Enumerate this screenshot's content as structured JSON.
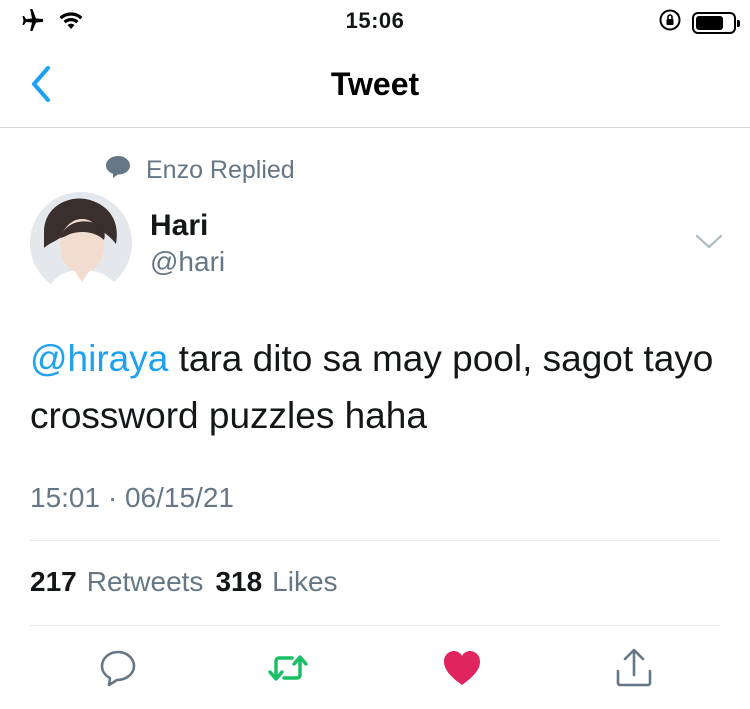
{
  "status_bar": {
    "time": "15:06",
    "left_icons": [
      "airplane-icon",
      "wifi-icon"
    ],
    "right_icons": [
      "orientation-lock-icon",
      "battery-icon"
    ],
    "battery_level": 0.75
  },
  "nav": {
    "title": "Tweet",
    "back_icon": "chevron-left-icon"
  },
  "tweet": {
    "context_icon": "speech-bubble-icon",
    "context_text": "Enzo Replied",
    "author": {
      "name": "Hari",
      "handle": "@hari"
    },
    "text": {
      "mention": "@hiraya",
      "body": " tara dito sa may pool, sagot tayo crossword puzzles haha"
    },
    "time": "15:01",
    "separator": "·",
    "date": "06/15/21",
    "stats": {
      "retweets_count": "217",
      "retweets_label": "Retweets",
      "likes_count": "318",
      "likes_label": "Likes"
    }
  },
  "actions": [
    "reply-icon",
    "retweet-icon",
    "like-icon",
    "share-icon"
  ],
  "colors": {
    "accent": "#1da1f2",
    "secondary_text": "#657786",
    "retweet_active": "#17bf63",
    "like_active": "#e0245e"
  }
}
